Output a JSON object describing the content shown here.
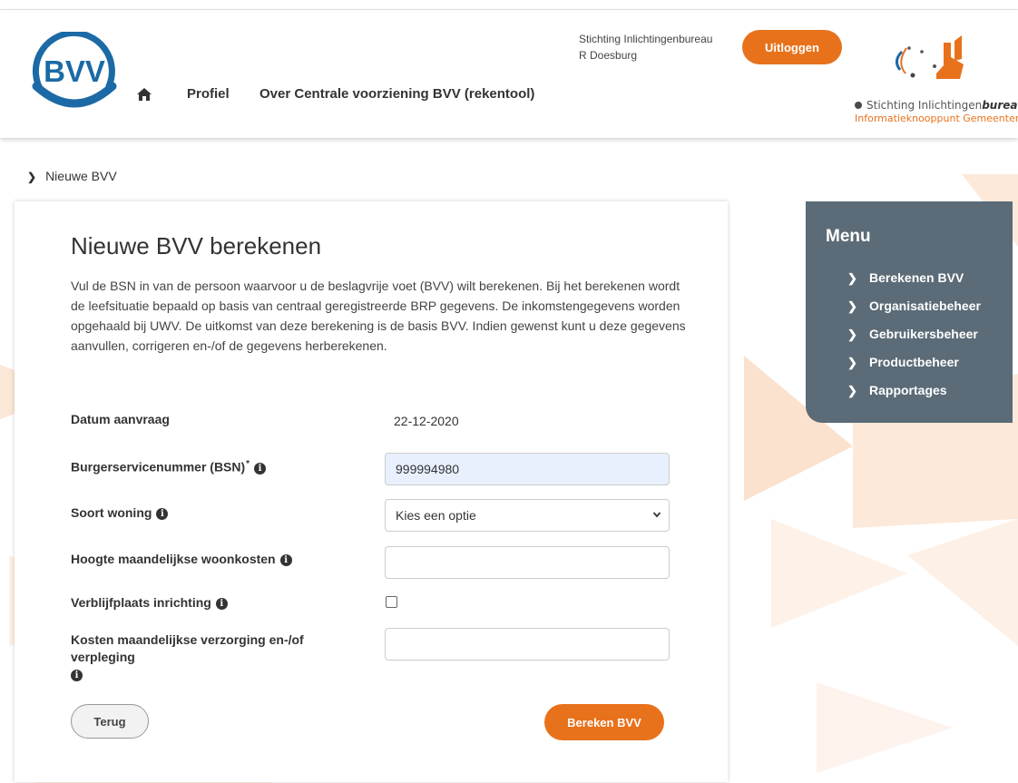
{
  "header": {
    "logo_text": "BVV",
    "nav": {
      "profiel": "Profiel",
      "over": "Over Centrale voorziening BVV (rekentool)"
    },
    "org_name": "Stichting Inlichtingenbureau",
    "user_name": "R Doesburg",
    "logout_label": "Uitloggen",
    "brand": {
      "line1_prefix": "Stichting Inlichtingen",
      "line1_suffix": "bureau",
      "line2": "Informatieknooppunt Gemeenten"
    }
  },
  "breadcrumb": {
    "current": "Nieuwe BVV"
  },
  "form": {
    "title": "Nieuwe BVV berekenen",
    "intro": "Vul de BSN in van de persoon waarvoor u de beslagvrije voet (BVV) wilt berekenen. Bij het berekenen wordt de leefsituatie bepaald op basis van centraal geregistreerde BRP gegevens. De inkomstengegevens worden opgehaald bij UWV. De uitkomst van deze berekening is de basis BVV. Indien gewenst kunt u deze gegevens aanvullen, corrigeren en-/of de gegevens herberekenen.",
    "datum_label": "Datum aanvraag",
    "datum_value": "22-12-2020",
    "bsn_label": "Burgerservicenummer (BSN)",
    "bsn_required": "*",
    "bsn_value": "999994980",
    "woning_label": "Soort woning",
    "woning_selected": "Kies een optie",
    "woonkosten_label": "Hoogte maandelijkse woonkosten",
    "woonkosten_value": "",
    "inrichting_label": "Verblijfplaats inrichting",
    "inrichting_checked": false,
    "verzorging_label_line1": "Kosten maandelijkse verzorging en-/of",
    "verzorging_label_line2": "verpleging",
    "verzorging_value": "",
    "back_label": "Terug",
    "submit_label": "Bereken BVV",
    "info_glyph": "i"
  },
  "menu": {
    "title": "Menu",
    "items": [
      "Berekenen BVV",
      "Organisatiebeheer",
      "Gebruikersbeheer",
      "Productbeheer",
      "Rapportages"
    ]
  },
  "colors": {
    "accent": "#e8721c",
    "menu_bg": "#5b6b77",
    "logo_blue": "#1b6aa5",
    "bsn_fill": "#e8f0fe"
  },
  "icons": [
    "home-icon",
    "info-icon",
    "chevron-right-icon",
    "chevron-down-icon"
  ]
}
